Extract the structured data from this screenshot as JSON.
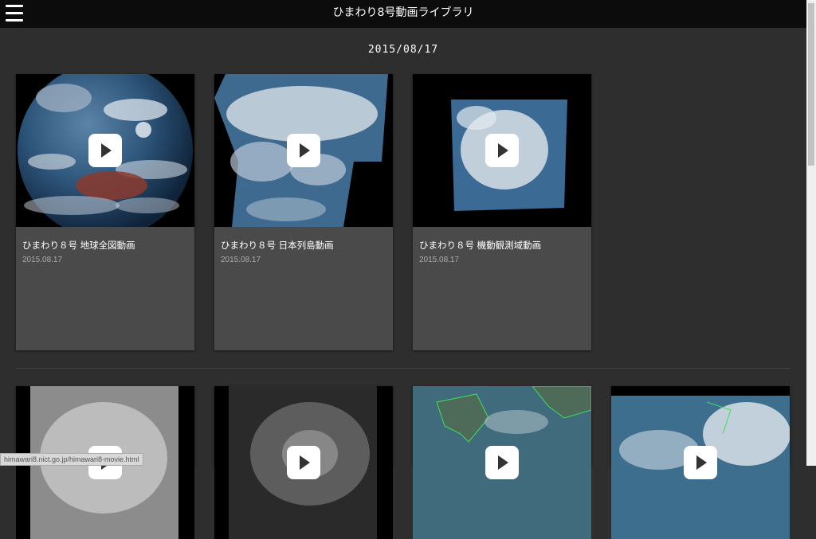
{
  "header": {
    "app_title": "ひまわり8号動画ライブラリ",
    "menu_icon": "hamburger-menu-icon"
  },
  "sections": [
    {
      "date": "2015/08/17",
      "cards": [
        {
          "title": "ひまわり８号 地球全図動画",
          "date": "2015.08.17"
        },
        {
          "title": "ひまわり８号 日本列島動画",
          "date": "2015.08.17"
        },
        {
          "title": "ひまわり８号 機動観測域動画",
          "date": "2015.08.17"
        }
      ]
    }
  ],
  "second_row_cards": 4,
  "status_bar": {
    "text": "himawari8.nict.go.jp/himawari8-movie.html"
  },
  "colors": {
    "background": "#2e2e2e",
    "topbar": "#0c0c0c",
    "card": "#4a4a4a",
    "play_button": "#ffffff"
  }
}
